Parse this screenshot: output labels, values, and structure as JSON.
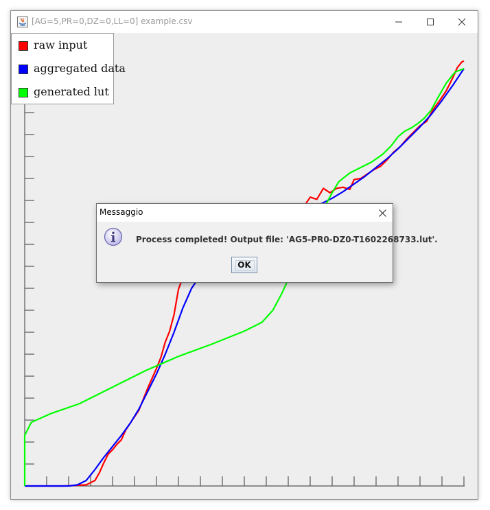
{
  "window": {
    "title": "[AG=5,PR=0,DZ=0,LL=0] example.csv",
    "controls": [
      "minimize-icon",
      "maximize-icon",
      "close-icon"
    ]
  },
  "legend": {
    "items": [
      {
        "label": "raw input",
        "color": "#ff0000"
      },
      {
        "label": "aggregated data",
        "color": "#0000ff"
      },
      {
        "label": "generated lut",
        "color": "#00ff00"
      }
    ]
  },
  "chart_data": {
    "type": "line",
    "xlabel": "",
    "ylabel": "",
    "xlim": [
      0,
      20
    ],
    "ylim": [
      0,
      20
    ],
    "x_ticks": 20,
    "y_ticks": 20,
    "grid": false,
    "legend_position": "top-left",
    "series": [
      {
        "name": "raw input",
        "color": "#ff0000",
        "points": [
          [
            0,
            0
          ],
          [
            1.8,
            0
          ],
          [
            2.8,
            0.05
          ],
          [
            3.2,
            0.25
          ],
          [
            3.4,
            0.6
          ],
          [
            3.6,
            1.05
          ],
          [
            3.8,
            1.45
          ],
          [
            4,
            1.65
          ],
          [
            4.2,
            1.9
          ],
          [
            4.4,
            2.1
          ],
          [
            4.6,
            2.55
          ],
          [
            4.8,
            2.85
          ],
          [
            5,
            3.15
          ],
          [
            5.2,
            3.45
          ],
          [
            5.4,
            3.95
          ],
          [
            5.6,
            4.45
          ],
          [
            5.8,
            4.9
          ],
          [
            6,
            5.35
          ],
          [
            6.2,
            5.85
          ],
          [
            6.4,
            6.55
          ],
          [
            6.6,
            7.05
          ],
          [
            6.8,
            7.8
          ],
          [
            7,
            8.95
          ],
          [
            7.2,
            9.5
          ],
          [
            7.5,
            9.95
          ],
          [
            8,
            10.15
          ],
          [
            8.5,
            10.35
          ],
          [
            9,
            10.5
          ],
          [
            9.5,
            10.8
          ],
          [
            10,
            11.05
          ],
          [
            10.5,
            11.2
          ],
          [
            10.9,
            11.5
          ],
          [
            11.1,
            12.05
          ],
          [
            11.3,
            11.75
          ],
          [
            11.6,
            12.15
          ],
          [
            11.9,
            12.05
          ],
          [
            12.2,
            12.45
          ],
          [
            12.5,
            12.5
          ],
          [
            12.8,
            12.85
          ],
          [
            13,
            13.15
          ],
          [
            13.3,
            13.05
          ],
          [
            13.6,
            13.55
          ],
          [
            13.9,
            13.35
          ],
          [
            14.2,
            13.55
          ],
          [
            14.5,
            13.6
          ],
          [
            14.8,
            13.5
          ],
          [
            15,
            13.95
          ],
          [
            15.3,
            14.0
          ],
          [
            15.6,
            14.2
          ],
          [
            15.9,
            14.4
          ],
          [
            16.2,
            14.55
          ],
          [
            16.5,
            14.85
          ],
          [
            16.8,
            15.2
          ],
          [
            17.1,
            15.45
          ],
          [
            17.4,
            15.8
          ],
          [
            17.7,
            16.1
          ],
          [
            18,
            16.4
          ],
          [
            18.3,
            16.6
          ],
          [
            18.6,
            17.15
          ],
          [
            18.9,
            17.55
          ],
          [
            19.2,
            18.0
          ],
          [
            19.5,
            18.6
          ],
          [
            19.7,
            19.05
          ],
          [
            19.9,
            19.3
          ],
          [
            20,
            19.35
          ]
        ]
      },
      {
        "name": "aggregated data",
        "color": "#0000ff",
        "points": [
          [
            0,
            0
          ],
          [
            2,
            0
          ],
          [
            2.4,
            0.05
          ],
          [
            2.8,
            0.25
          ],
          [
            3.2,
            0.75
          ],
          [
            3.6,
            1.3
          ],
          [
            4,
            1.8
          ],
          [
            4.4,
            2.3
          ],
          [
            4.8,
            2.85
          ],
          [
            5.2,
            3.5
          ],
          [
            5.6,
            4.3
          ],
          [
            6,
            5.1
          ],
          [
            6.4,
            6.0
          ],
          [
            6.8,
            7.0
          ],
          [
            7.2,
            8.1
          ],
          [
            7.6,
            9.0
          ],
          [
            8,
            9.6
          ],
          [
            8.5,
            10.0
          ],
          [
            9,
            10.3
          ],
          [
            9.5,
            10.6
          ],
          [
            10,
            10.9
          ],
          [
            10.5,
            11.2
          ],
          [
            11,
            11.55
          ],
          [
            11.5,
            11.85
          ],
          [
            12,
            12.1
          ],
          [
            12.5,
            12.35
          ],
          [
            13,
            12.6
          ],
          [
            13.5,
            12.85
          ],
          [
            14,
            13.1
          ],
          [
            14.5,
            13.4
          ],
          [
            15,
            13.75
          ],
          [
            15.5,
            14.1
          ],
          [
            16,
            14.5
          ],
          [
            16.5,
            14.9
          ],
          [
            17,
            15.35
          ],
          [
            17.5,
            15.85
          ],
          [
            18,
            16.35
          ],
          [
            18.5,
            16.9
          ],
          [
            19,
            17.55
          ],
          [
            19.5,
            18.25
          ],
          [
            20,
            19.0
          ]
        ]
      },
      {
        "name": "generated lut",
        "color": "#00ff00",
        "points": [
          [
            0,
            0
          ],
          [
            0,
            2.3
          ],
          [
            0.3,
            2.9
          ],
          [
            1.2,
            3.3
          ],
          [
            2.5,
            3.75
          ],
          [
            4,
            4.5
          ],
          [
            5.5,
            5.25
          ],
          [
            7,
            5.9
          ],
          [
            8.5,
            6.45
          ],
          [
            10,
            7.05
          ],
          [
            10.8,
            7.45
          ],
          [
            11.3,
            8.0
          ],
          [
            11.7,
            8.75
          ],
          [
            12,
            9.4
          ],
          [
            12.3,
            10.0
          ],
          [
            12.7,
            10.7
          ],
          [
            13.1,
            11.4
          ],
          [
            13.3,
            11.95
          ],
          [
            13.6,
            12.6
          ],
          [
            14,
            13.35
          ],
          [
            14.3,
            13.85
          ],
          [
            14.8,
            14.25
          ],
          [
            15.3,
            14.5
          ],
          [
            15.8,
            14.75
          ],
          [
            16.3,
            15.1
          ],
          [
            16.7,
            15.5
          ],
          [
            17,
            15.9
          ],
          [
            17.3,
            16.15
          ],
          [
            17.6,
            16.3
          ],
          [
            17.9,
            16.5
          ],
          [
            18.2,
            16.75
          ],
          [
            18.5,
            17.1
          ],
          [
            18.8,
            17.65
          ],
          [
            19.2,
            18.35
          ],
          [
            19.6,
            18.85
          ],
          [
            20,
            19.0
          ]
        ]
      }
    ]
  },
  "dialog": {
    "title": "Messaggio",
    "message": "Process completed! Output file: 'AG5-PR0-DZ0-T1602268733.lut'.",
    "ok_label": "OK"
  }
}
